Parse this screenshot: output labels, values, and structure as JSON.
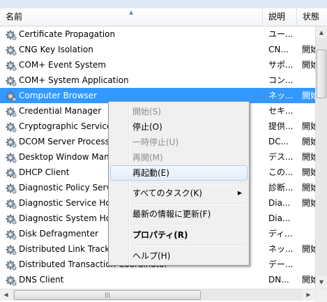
{
  "columns": {
    "name": "名前",
    "description": "説明",
    "status": "状態"
  },
  "services": [
    {
      "name": "Certificate Propagation",
      "description": "ユー...",
      "status": ""
    },
    {
      "name": "CNG Key Isolation",
      "description": "CN...",
      "status": "開始"
    },
    {
      "name": "COM+ Event System",
      "description": "サポ...",
      "status": "開始"
    },
    {
      "name": "COM+ System Application",
      "description": "コン...",
      "status": ""
    },
    {
      "name": "Computer Browser",
      "description": "ネッ...",
      "status": "開始"
    },
    {
      "name": "Credential Manager",
      "description": "セキ...",
      "status": ""
    },
    {
      "name": "Cryptographic Service",
      "description": "提供...",
      "status": "開始"
    },
    {
      "name": "DCOM Server Process",
      "description": "DC...",
      "status": "開始"
    },
    {
      "name": "Desktop Window Mana",
      "description": "デス...",
      "status": "開始"
    },
    {
      "name": "DHCP Client",
      "description": "この...",
      "status": "開始"
    },
    {
      "name": "Diagnostic Policy Serv",
      "description": "診断...",
      "status": "開始"
    },
    {
      "name": "Diagnostic Service Ho",
      "description": "Dia...",
      "status": "開始"
    },
    {
      "name": "Diagnostic System Ho",
      "description": "Dia...",
      "status": ""
    },
    {
      "name": "Disk Defragmenter",
      "description": "ディ...",
      "status": ""
    },
    {
      "name": "Distributed Link Track",
      "description": "ネッ...",
      "status": "開始"
    },
    {
      "name": "Distributed Transaction Coordinator",
      "description": "デー...",
      "status": ""
    },
    {
      "name": "DNS Client",
      "description": "DN...",
      "status": "開始"
    }
  ],
  "selected_index": 4,
  "context_menu": {
    "start": "開始(S)",
    "stop": "停止(O)",
    "pause": "一時停止(U)",
    "resume": "再開(M)",
    "restart": "再起動(E)",
    "all_tasks": "すべてのタスク(K)",
    "refresh": "最新の情報に更新(F)",
    "properties": "プロパティ(R)",
    "help": "ヘルプ(H)"
  },
  "colors": {
    "selection": "#3399ff",
    "menu_hover_border": "#aeccf1"
  },
  "icons": {
    "service": "gear-icon",
    "sort": "sort-ascending-icon"
  }
}
